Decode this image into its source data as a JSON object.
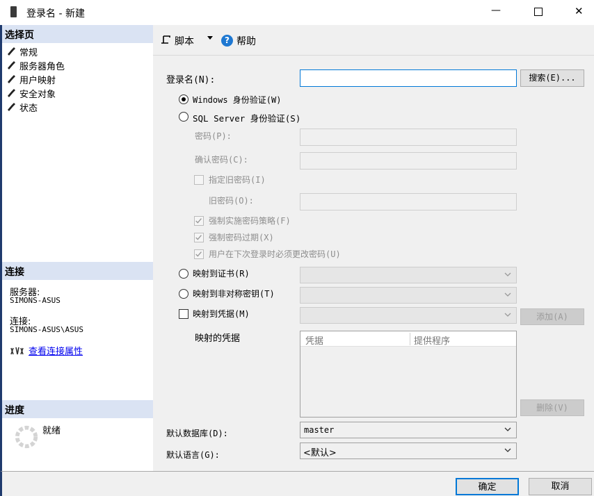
{
  "window": {
    "title": "登录名 - 新建",
    "minimize": "—",
    "maximize": "☐",
    "close": "✕"
  },
  "sidebar": {
    "select_page_header": "选择页",
    "pages": [
      {
        "label": "常规"
      },
      {
        "label": "服务器角色"
      },
      {
        "label": "用户映射"
      },
      {
        "label": "安全对象"
      },
      {
        "label": "状态"
      }
    ],
    "connection_header": "连接",
    "server_label": "服务器:",
    "server_value": "SIMONS-ASUS",
    "connection_label": "连接:",
    "connection_value": "SIMONS-ASUS\\ASUS",
    "view_props_link": "查看连接属性",
    "progress_header": "进度",
    "progress_status": "就绪"
  },
  "toolbar": {
    "script_label": "脚本",
    "help_label": "帮助"
  },
  "form": {
    "login_name_label": "登录名(N):",
    "login_name_value": "",
    "search_button": "搜索(E)...",
    "windows_auth": "Windows 身份验证(W)",
    "sql_auth": "SQL Server 身份验证(S)",
    "password_label": "密码(P):",
    "confirm_password_label": "确认密码(C):",
    "specify_old_password": "指定旧密码(I)",
    "old_password_label": "旧密码(O):",
    "enforce_policy": "强制实施密码策略(F)",
    "enforce_expiration": "强制密码过期(X)",
    "must_change": "用户在下次登录时必须更改密码(U)",
    "map_cert": "映射到证书(R)",
    "map_asym_key": "映射到非对称密钥(T)",
    "map_credential": "映射到凭据(M)",
    "add_button": "添加(A)",
    "mapped_credentials_label": "映射的凭据",
    "cred_col_credential": "凭据",
    "cred_col_provider": "提供程序",
    "remove_button": "删除(V)",
    "default_db_label": "默认数据库(D):",
    "default_db_value": "master",
    "default_lang_label": "默认语言(G):",
    "default_lang_value": "<默认>"
  },
  "footer": {
    "ok_button": "确定",
    "cancel_button": "取消"
  },
  "colors": {
    "section_header_bg": "#dae3f3",
    "accent": "#0066cc",
    "link": "#0000ee"
  }
}
